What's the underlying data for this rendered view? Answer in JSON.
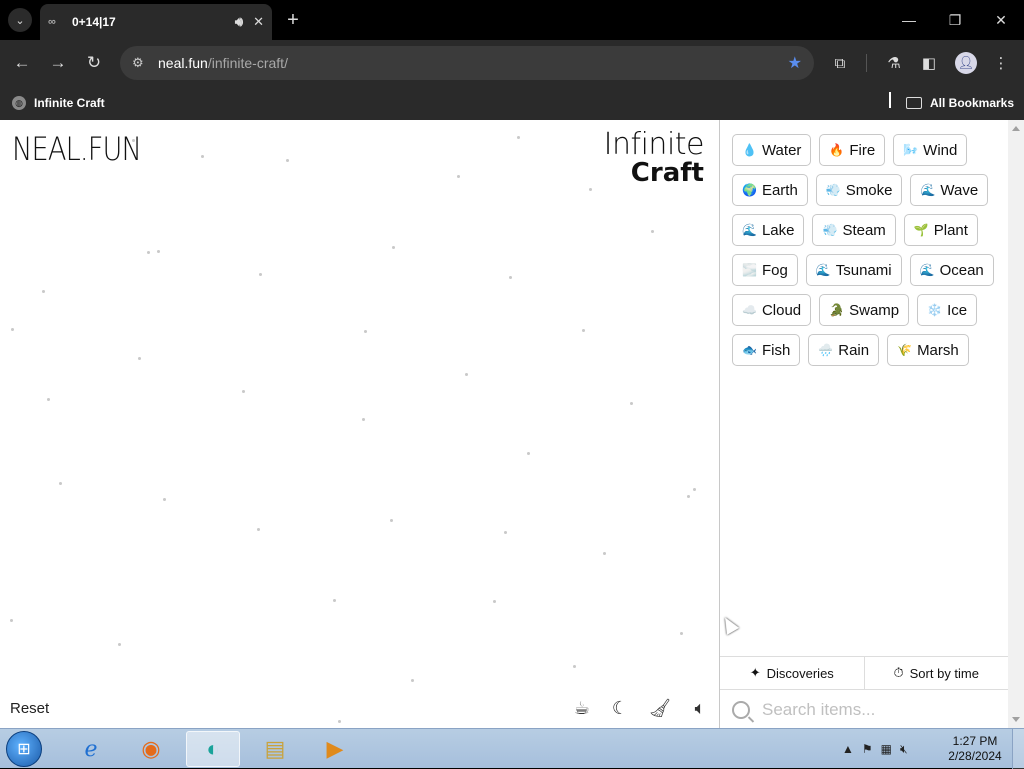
{
  "browser": {
    "tab_title": "0+14|17",
    "url_host": "neal.fun",
    "url_path": "/infinite-craft/",
    "bookmark_label": "Infinite Craft",
    "all_bookmarks_label": "All Bookmarks",
    "accent": "#5a8dee"
  },
  "page": {
    "site_logo": "NEAL.FUN",
    "title_line1": "Infinite",
    "title_line2": "Craft",
    "reset_label": "Reset"
  },
  "elements": [
    {
      "icon": "💧",
      "name": "Water"
    },
    {
      "icon": "🔥",
      "name": "Fire"
    },
    {
      "icon": "🌬️",
      "name": "Wind"
    },
    {
      "icon": "🌍",
      "name": "Earth"
    },
    {
      "icon": "💨",
      "name": "Smoke"
    },
    {
      "icon": "🌊",
      "name": "Wave"
    },
    {
      "icon": "🌊",
      "name": "Lake"
    },
    {
      "icon": "💨",
      "name": "Steam"
    },
    {
      "icon": "🌱",
      "name": "Plant"
    },
    {
      "icon": "🌫️",
      "name": "Fog"
    },
    {
      "icon": "🌊",
      "name": "Tsunami"
    },
    {
      "icon": "🌊",
      "name": "Ocean"
    },
    {
      "icon": "☁️",
      "name": "Cloud"
    },
    {
      "icon": "🐊",
      "name": "Swamp"
    },
    {
      "icon": "❄️",
      "name": "Ice"
    },
    {
      "icon": "🐟",
      "name": "Fish"
    },
    {
      "icon": "🌧️",
      "name": "Rain"
    },
    {
      "icon": "🌾",
      "name": "Marsh"
    }
  ],
  "sidebar": {
    "discoveries_label": "Discoveries",
    "sort_label": "Sort by time",
    "search_placeholder": "Search items..."
  },
  "taskbar": {
    "time": "1:27 PM",
    "date": "2/28/2024"
  }
}
